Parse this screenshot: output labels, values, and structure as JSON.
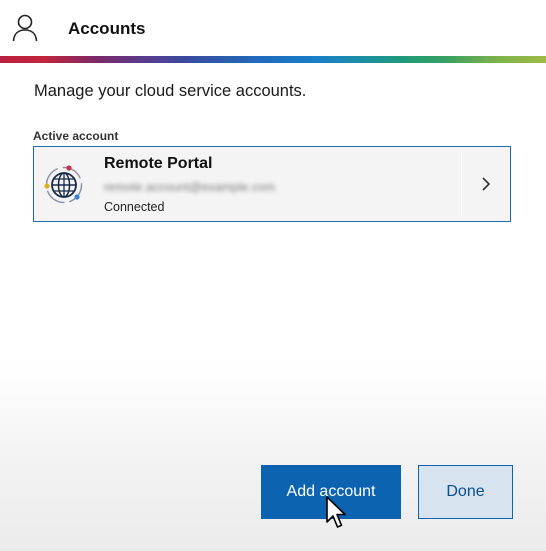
{
  "header": {
    "title": "Accounts",
    "icon": "user-icon"
  },
  "brand_stripe": {
    "colors": [
      "#b9203f",
      "#5b3b8c",
      "#1e6fc0",
      "#1f9a7a",
      "#9dbb46"
    ]
  },
  "main": {
    "intro": "Manage your cloud service accounts.",
    "active_label": "Active account",
    "account": {
      "name": "Remote Portal",
      "email": "remote.account@example.com",
      "status": "Connected",
      "icon": "globe-icon",
      "action_icon": "chevron-right-icon"
    }
  },
  "footer": {
    "add_label": "Add account",
    "done_label": "Done"
  },
  "colors": {
    "accent": "#0c63b0",
    "card_border": "#1d6ab3",
    "done_bg": "#d7e3ef"
  }
}
